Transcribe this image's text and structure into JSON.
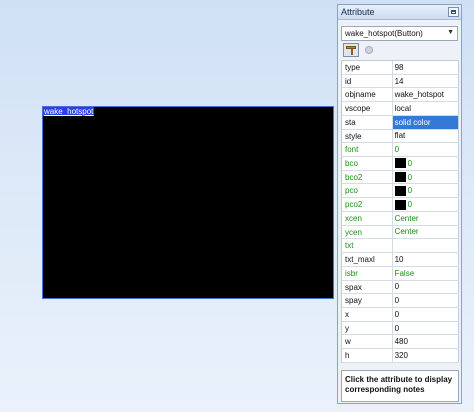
{
  "canvas": {
    "component_label": "wake_hotspot"
  },
  "panel": {
    "title": "Attribute",
    "selected_object": "wake_hotspot(Button)",
    "toolbar": [
      "hammer-icon",
      "pin-icon"
    ],
    "notes": "Click the attribute to display corresponding notes",
    "selection_color": "#3478d8",
    "green_color": "#1d8a1d"
  },
  "attributes": [
    {
      "name": "type",
      "value": "98",
      "green": false
    },
    {
      "name": "id",
      "value": "14",
      "green": false
    },
    {
      "name": "objname",
      "value": "wake_hotspot",
      "green": false
    },
    {
      "name": "vscope",
      "value": "local",
      "green": false
    },
    {
      "name": "sta",
      "value": "solid color",
      "green": false,
      "selected": true
    },
    {
      "name": "style",
      "value": "flat",
      "green": false
    },
    {
      "name": "font",
      "value": "0",
      "green": true
    },
    {
      "name": "bco",
      "value": "0",
      "green": true,
      "swatch": "#000000"
    },
    {
      "name": "bco2",
      "value": "0",
      "green": true,
      "swatch": "#000000"
    },
    {
      "name": "pco",
      "value": "0",
      "green": true,
      "swatch": "#000000"
    },
    {
      "name": "pco2",
      "value": "0",
      "green": true,
      "swatch": "#000000"
    },
    {
      "name": "xcen",
      "value": "Center",
      "green": true
    },
    {
      "name": "ycen",
      "value": "Center",
      "green": true
    },
    {
      "name": "txt",
      "value": "",
      "green": true
    },
    {
      "name": "txt_maxl",
      "value": "10",
      "green": false
    },
    {
      "name": "isbr",
      "value": "False",
      "green": true
    },
    {
      "name": "spax",
      "value": "0",
      "green": false
    },
    {
      "name": "spay",
      "value": "0",
      "green": false
    },
    {
      "name": "x",
      "value": "0",
      "green": false
    },
    {
      "name": "y",
      "value": "0",
      "green": false
    },
    {
      "name": "w",
      "value": "480",
      "green": false
    },
    {
      "name": "h",
      "value": "320",
      "green": false
    }
  ]
}
